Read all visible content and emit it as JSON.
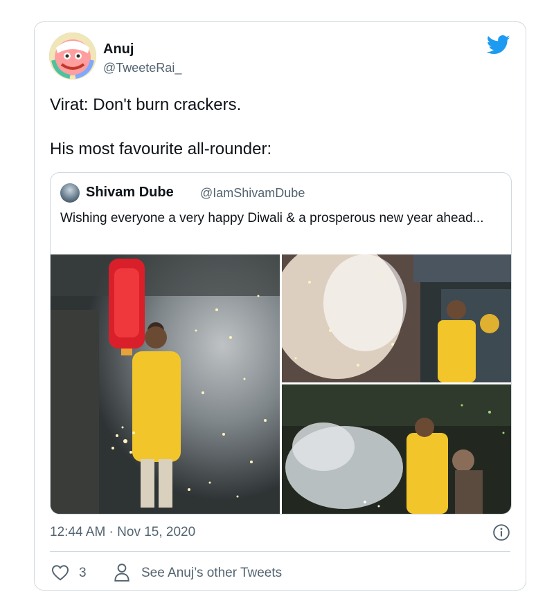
{
  "author": {
    "name": "Anuj",
    "handle": "@TweeteRai_",
    "avatar_icon": "colorful-portrait-avatar"
  },
  "brand_icon": "twitter-bird-icon",
  "brand_color": "#1d9bf0",
  "tweet": {
    "line1": "Virat: Don't burn crackers.",
    "line2": "His most favourite all-rounder:"
  },
  "quoted": {
    "name": "Shivam Dube",
    "handle": "@IamShivamDube",
    "text": "Wishing everyone a very happy Diwali & a prosperous new year ahead...",
    "photos": [
      "diwali-photo-lantern-sparkler",
      "diwali-photo-fireworks",
      "diwali-photo-smoke"
    ]
  },
  "meta": {
    "timestamp": "12:44 AM · Nov 15, 2020"
  },
  "actions": {
    "like_count": "3",
    "other_tweets_label": "See Anuj’s other Tweets"
  },
  "colors": {
    "text": "#0f1419",
    "secondary": "#536471",
    "border": "#cfd9de"
  }
}
